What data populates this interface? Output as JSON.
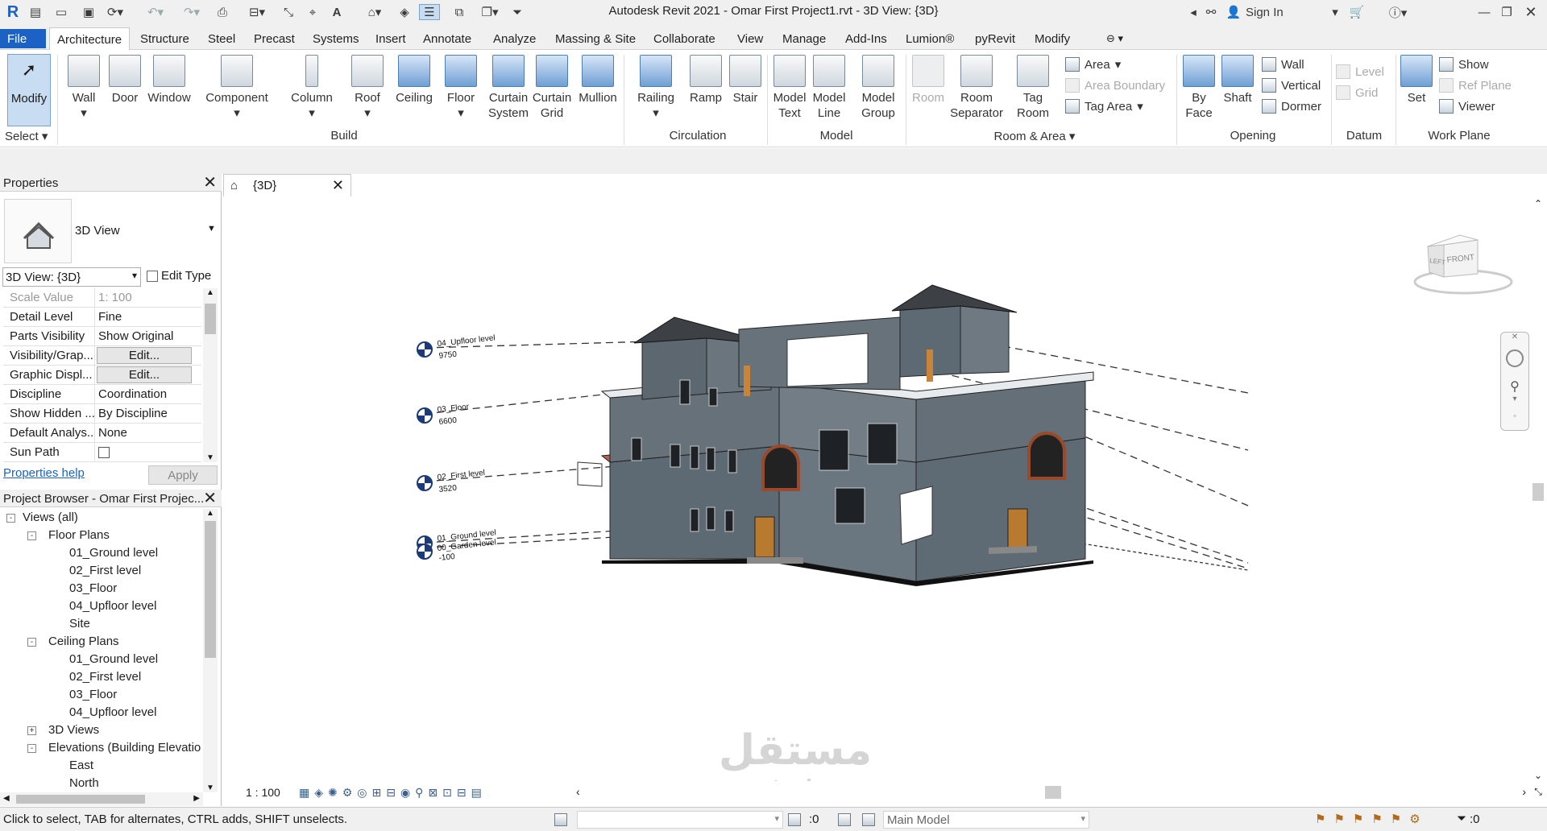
{
  "titlebar": {
    "title": "Autodesk Revit 2021 - Omar First Project1.rvt - 3D View: {3D}",
    "app_logo": "R",
    "sign_in": "Sign In",
    "icons": [
      "open-icon",
      "save-icon",
      "sync-icon",
      "undo-icon",
      "redo-icon",
      "print-icon",
      "measure-icon",
      "text-icon",
      "3d-view-icon",
      "section-icon",
      "close-hidden-icon",
      "switch-windows-icon"
    ]
  },
  "tabs": [
    "File",
    "Architecture",
    "Structure",
    "Steel",
    "Precast",
    "Systems",
    "Insert",
    "Annotate",
    "Analyze",
    "Massing & Site",
    "Collaborate",
    "View",
    "Manage",
    "Add-Ins",
    "Lumion®",
    "pyRevit",
    "Modify"
  ],
  "ribbon": {
    "select": {
      "modify": "Modify",
      "select_label": "Select"
    },
    "build": {
      "label": "Build",
      "tools": [
        "Wall",
        "Door",
        "Window",
        "Component",
        "Column",
        "Roof",
        "Ceiling",
        "Floor",
        "Curtain\nSystem",
        "Curtain\nGrid",
        "Mullion"
      ]
    },
    "circulation": {
      "label": "Circulation",
      "tools": [
        "Railing",
        "Ramp",
        "Stair"
      ]
    },
    "model": {
      "label": "Model",
      "tools": [
        "Model\nText",
        "Model\nLine",
        "Model\nGroup"
      ]
    },
    "room_area": {
      "label": "Room & Area",
      "tools": [
        "Room",
        "Room\nSeparator",
        "Tag\nRoom"
      ],
      "small": [
        "Area",
        "Area  Boundary",
        "Tag  Area"
      ]
    },
    "opening": {
      "label": "Opening",
      "tools": [
        "By\nFace",
        "Shaft"
      ],
      "small": [
        "Wall",
        "Vertical",
        "Dormer"
      ]
    },
    "datum": {
      "label": "Datum",
      "small": [
        "Level",
        "Grid"
      ]
    },
    "work_plane": {
      "label": "Work Plane",
      "tools": [
        "Set"
      ],
      "small": [
        "Show",
        "Ref  Plane",
        "Viewer"
      ]
    }
  },
  "properties": {
    "header": "Properties",
    "type_name": "3D View",
    "instance_selector": "3D View: {3D}",
    "edit_type": "Edit Type",
    "rows": [
      {
        "k": "Scale Value",
        "v": "1:  100",
        "dim": true
      },
      {
        "k": "Detail Level",
        "v": "Fine"
      },
      {
        "k": "Parts Visibility",
        "v": "Show Original"
      },
      {
        "k": "Visibility/Grap...",
        "btn": "Edit..."
      },
      {
        "k": "Graphic Displ...",
        "btn": "Edit..."
      },
      {
        "k": "Discipline",
        "v": "Coordination"
      },
      {
        "k": "Show Hidden ...",
        "v": "By Discipline"
      },
      {
        "k": "Default Analys...",
        "v": "None"
      },
      {
        "k": "Sun Path",
        "v": ""
      }
    ],
    "help_link": "Properties help",
    "apply": "Apply"
  },
  "browser": {
    "header": "Project Browser - Omar First Projec...",
    "items": [
      {
        "label": "Views (all)",
        "level": 0,
        "toggle": "-"
      },
      {
        "label": "Floor Plans",
        "level": 1,
        "toggle": "-"
      },
      {
        "label": "01_Ground level",
        "level": 2
      },
      {
        "label": "02_First level",
        "level": 2
      },
      {
        "label": "03_Floor",
        "level": 2
      },
      {
        "label": "04_Upfloor level",
        "level": 2
      },
      {
        "label": "Site",
        "level": 2
      },
      {
        "label": "Ceiling Plans",
        "level": 1,
        "toggle": "-"
      },
      {
        "label": "01_Ground level",
        "level": 2
      },
      {
        "label": "02_First level",
        "level": 2
      },
      {
        "label": "03_Floor",
        "level": 2
      },
      {
        "label": "04_Upfloor level",
        "level": 2
      },
      {
        "label": "3D Views",
        "level": 1,
        "toggle": "+"
      },
      {
        "label": "Elevations (Building Elevatio",
        "level": 1,
        "toggle": "-"
      },
      {
        "label": "East",
        "level": 2
      },
      {
        "label": "North",
        "level": 2
      }
    ]
  },
  "view": {
    "tab_label": "{3D}",
    "scale": "1 : 100",
    "viewcube": {
      "left": "LEFT",
      "front": "FRONT"
    },
    "levels": [
      {
        "name": "04_Upfloor level",
        "elev": "9750"
      },
      {
        "name": "03_Floor",
        "elev": "6600"
      },
      {
        "name": "02_First level",
        "elev": "3520"
      },
      {
        "name": "01_Ground level",
        "elev": ""
      },
      {
        "name": "00_Garden level",
        "elev": "-100"
      }
    ],
    "watermark": {
      "arabic": "مستقل",
      "latin": "mostaql.com"
    }
  },
  "status": {
    "message": "Click to select, TAB for alternates, CTRL adds, SHIFT unselects.",
    "count": ":0",
    "model": "Main Model",
    "filter_count": ":0"
  },
  "colors": {
    "accent": "#1c62c4",
    "wall": "#5e6a73",
    "roof": "#3d4145",
    "door": "#b87a2e"
  }
}
